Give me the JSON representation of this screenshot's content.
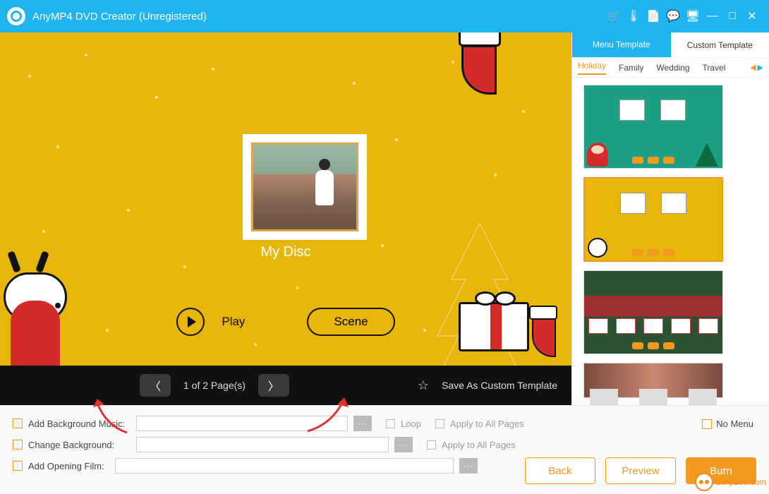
{
  "app": {
    "title": "AnyMP4 DVD Creator (Unregistered)"
  },
  "titlebar_icons": [
    "cart-icon",
    "thermometer-icon",
    "page-icon",
    "chat-icon",
    "display-icon",
    "minimize-icon",
    "maximize-icon",
    "close-icon"
  ],
  "preview": {
    "disc_title": "My Disc",
    "play_label": "Play",
    "scene_label": "Scene"
  },
  "pager": {
    "text": "1 of 2 Page(s)",
    "save_template": "Save As Custom Template"
  },
  "rightpanel": {
    "tabs": {
      "menu": "Menu Template",
      "custom": "Custom Template"
    },
    "categories": [
      "Holiday",
      "Family",
      "Wedding",
      "Travel"
    ],
    "active_category": "Holiday",
    "selected_index": 1
  },
  "options": {
    "bg_music": {
      "label": "Add Background Music:",
      "loop": "Loop",
      "apply": "Apply to All Pages"
    },
    "change_bg": {
      "label": "Change Background:",
      "apply": "Apply to All Pages"
    },
    "opening": {
      "label": "Add Opening Film:"
    },
    "no_menu": "No Menu"
  },
  "buttons": {
    "back": "Back",
    "preview": "Preview",
    "burn": "Burn"
  },
  "watermark": {
    "host": "danji100.com"
  }
}
